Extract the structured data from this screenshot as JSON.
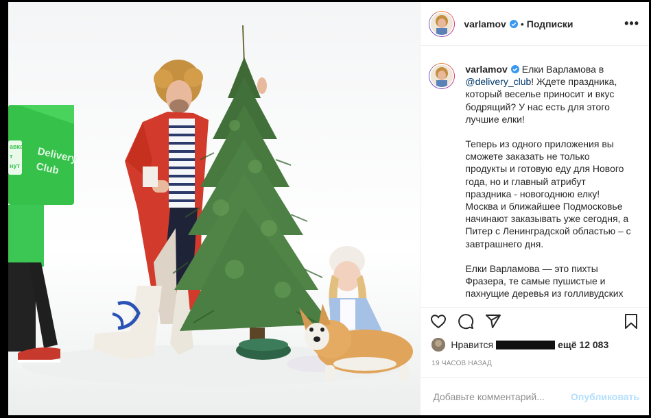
{
  "header": {
    "username": "varlamov",
    "separator": "•",
    "follow_label": "Подписки",
    "more_label": "•••"
  },
  "caption": {
    "username": "varlamov",
    "p1_a": "Елки Варламова в",
    "mention": "@delivery_club",
    "p1_b": "! Ждете праздника, который веселье приносит и вкус бодрящий? У нас есть для этого лучшие елки!",
    "p2": "Теперь из одного приложения вы сможете заказать не только продукты и готовую еду для Нового года, но и главный атрибут праздника - новогоднюю елку! Москва и ближайшее Подмосковье начинают заказывать уже сегодня, а Питер с Ленинградской областью – с завтрашнего дня.",
    "p3": "Елки Варламова — это пихты Фразера, те самые пушистые и пахнущие деревья из голливудских"
  },
  "photo": {
    "bag_text_lines": [
      "авка",
      "т",
      "нут"
    ],
    "bag_brand": [
      "Delivery",
      "Club"
    ]
  },
  "likes": {
    "prefix": "Нравится",
    "suffix": "ещё 12 083"
  },
  "timestamp": "19 часов назад",
  "comment": {
    "placeholder": "Добавьте комментарий...",
    "publish_label": "Опубликовать"
  },
  "colors": {
    "verified": "#3897f0",
    "link": "#00376b",
    "publish_disabled": "#b2dffc",
    "delivery_green": "#3bc84c"
  },
  "icons": [
    "heart-icon",
    "comment-icon",
    "share-icon",
    "bookmark-icon",
    "verified-icon",
    "more-icon"
  ]
}
